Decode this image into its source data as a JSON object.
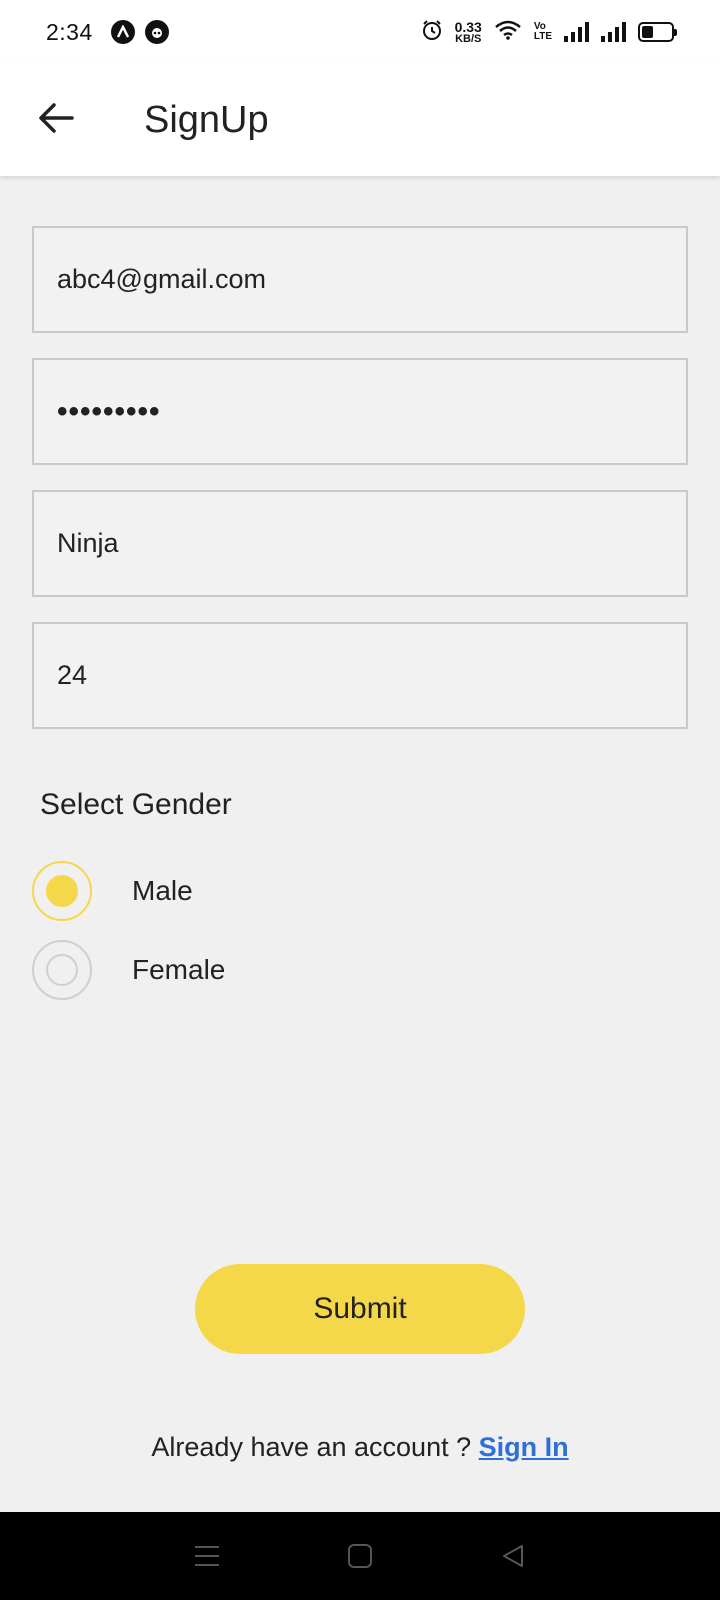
{
  "status_bar": {
    "time": "2:34",
    "net_speed_value": "0.33",
    "net_speed_unit": "KB/S",
    "volte_top": "Vo",
    "volte_bottom": "LTE",
    "icons": [
      "app-a-icon",
      "panda-icon",
      "alarm-icon",
      "wifi-icon",
      "volte-icon",
      "signal-icon",
      "signal-icon",
      "battery-icon"
    ]
  },
  "app_bar": {
    "title": "SignUp",
    "back_icon": "arrow-left-icon"
  },
  "form": {
    "email_value": "abc4@gmail.com",
    "password_value": "•••••••••",
    "name_value": "Ninja",
    "age_value": "24"
  },
  "gender": {
    "label": "Select Gender",
    "options": [
      {
        "label": "Male",
        "selected": true
      },
      {
        "label": "Female",
        "selected": false
      }
    ]
  },
  "actions": {
    "submit_label": "Submit",
    "signin_prompt": "Already have an account ? ",
    "signin_link": "Sign In"
  },
  "colors": {
    "accent_yellow": "#f5d84a",
    "link_blue": "#2f6fd6",
    "background": "#f0f0f0"
  },
  "nav_bar": {
    "icons": [
      "menu-icon",
      "home-square-icon",
      "back-triangle-icon"
    ]
  }
}
